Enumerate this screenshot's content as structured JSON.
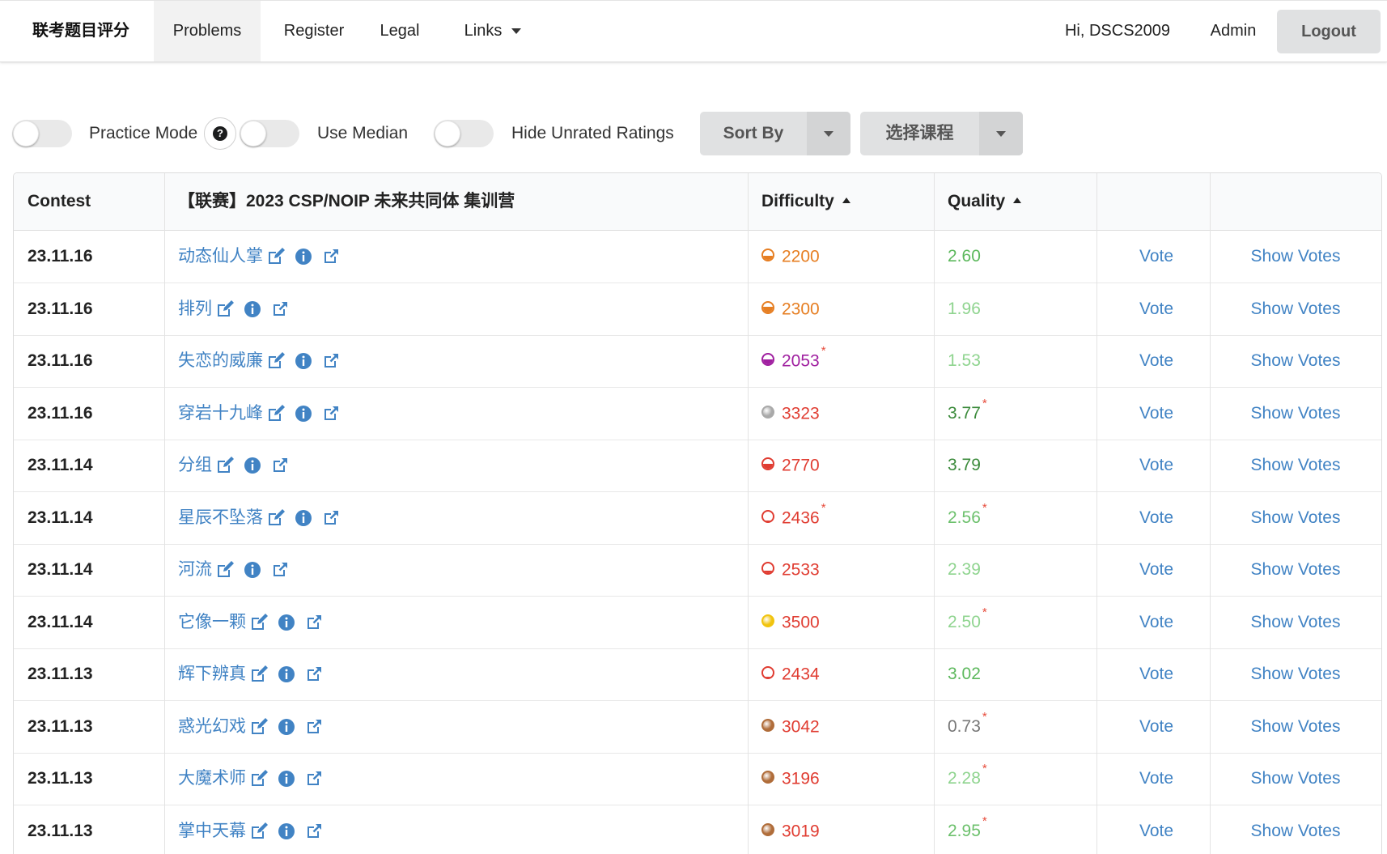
{
  "nav": {
    "brand": "联考题目评分",
    "items": [
      "Problems",
      "Register",
      "Legal",
      "Links"
    ],
    "greeting": "Hi, DSCS2009",
    "admin": "Admin",
    "logout": "Logout"
  },
  "filters": {
    "practice_mode": "Practice Mode",
    "help_glyph": "?",
    "use_median": "Use Median",
    "hide_unrated": "Hide Unrated Ratings",
    "sort_by": "Sort By",
    "select_course": "选择课程"
  },
  "table": {
    "headers": {
      "contest": "Contest",
      "problem": "【联赛】2023 CSP/NOIP 未来共同体 集训营",
      "difficulty": "Difficulty",
      "quality": "Quality"
    },
    "vote_label": "Vote",
    "show_votes_label": "Show Votes",
    "rows": [
      {
        "date": "23.11.16",
        "problem": "动态仙人掌",
        "difficulty": "2200",
        "difficulty_color": "#e67e22",
        "difficulty_fill": 0.45,
        "difficulty_starred": false,
        "quality": "2.60",
        "quality_color": "#5cb85c",
        "quality_starred": false
      },
      {
        "date": "23.11.16",
        "problem": "排列",
        "difficulty": "2300",
        "difficulty_color": "#e67e22",
        "difficulty_fill": 0.6,
        "difficulty_starred": false,
        "quality": "1.96",
        "quality_color": "#8fd48f",
        "quality_starred": false
      },
      {
        "date": "23.11.16",
        "problem": "失恋的威廉",
        "difficulty": "2053",
        "difficulty_color": "#a020a0",
        "difficulty_fill": 0.55,
        "difficulty_starred": true,
        "quality": "1.53",
        "quality_color": "#8fd48f",
        "quality_starred": false
      },
      {
        "date": "23.11.16",
        "problem": "穿岩十九峰",
        "difficulty": "3323",
        "difficulty_color": "#e03c31",
        "difficulty_fill": 1,
        "difficulty_starred": false,
        "quality": "3.77",
        "quality_color": "#3a8a3a",
        "quality_starred": true
      },
      {
        "date": "23.11.14",
        "problem": "分组",
        "difficulty": "2770",
        "difficulty_color": "#e03c31",
        "difficulty_fill": 0.55,
        "difficulty_starred": false,
        "quality": "3.79",
        "quality_color": "#3a8a3a",
        "quality_starred": false
      },
      {
        "date": "23.11.14",
        "problem": "星辰不坠落",
        "difficulty": "2436",
        "difficulty_color": "#e03c31",
        "difficulty_fill": 0.1,
        "difficulty_starred": true,
        "quality": "2.56",
        "quality_color": "#6cc06c",
        "quality_starred": true
      },
      {
        "date": "23.11.14",
        "problem": "河流",
        "difficulty": "2533",
        "difficulty_color": "#e03c31",
        "difficulty_fill": 0.3,
        "difficulty_starred": false,
        "quality": "2.39",
        "quality_color": "#8fd48f",
        "quality_starred": false
      },
      {
        "date": "23.11.14",
        "problem": "它像一颗",
        "difficulty": "3500",
        "difficulty_color": "#e03c31",
        "difficulty_fill": 1,
        "difficulty_starred": false,
        "quality": "2.50",
        "quality_color": "#8fd48f",
        "quality_starred": true
      },
      {
        "date": "23.11.13",
        "problem": "辉下辨真",
        "difficulty": "2434",
        "difficulty_color": "#e03c31",
        "difficulty_fill": 0.1,
        "difficulty_starred": false,
        "quality": "3.02",
        "quality_color": "#5cb85c",
        "quality_starred": false
      },
      {
        "date": "23.11.13",
        "problem": "惑光幻戏",
        "difficulty": "3042",
        "difficulty_color": "#e03c31",
        "difficulty_fill": 1,
        "difficulty_starred": false,
        "quality": "0.73",
        "quality_color": "#777777",
        "quality_starred": true
      },
      {
        "date": "23.11.13",
        "problem": "大魔术师",
        "difficulty": "3196",
        "difficulty_color": "#e03c31",
        "difficulty_fill": 1,
        "difficulty_starred": false,
        "quality": "2.28",
        "quality_color": "#8fd48f",
        "quality_starred": true
      },
      {
        "date": "23.11.13",
        "problem": "掌中天幕",
        "difficulty": "3019",
        "difficulty_color": "#e03c31",
        "difficulty_fill": 1,
        "difficulty_starred": false,
        "quality": "2.95",
        "quality_color": "#6cc06c",
        "quality_starred": true
      }
    ]
  },
  "icons": {
    "medal_colors": {
      "silver": "#a9a9a9",
      "gold": "#f1c40f",
      "bronze": "#b06d3a"
    },
    "row_icon_names": [
      "edit-icon",
      "info-icon",
      "external-link-icon"
    ],
    "row_medals": [
      null,
      null,
      null,
      "silver",
      null,
      null,
      null,
      "gold",
      null,
      "bronze",
      "bronze",
      "bronze"
    ]
  }
}
